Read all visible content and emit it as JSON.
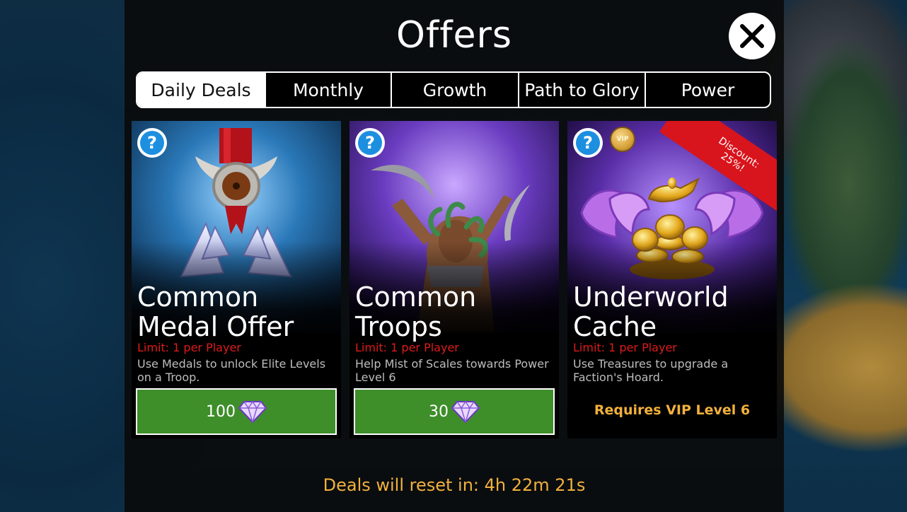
{
  "title": "Offers",
  "tabs": [
    {
      "label": "Daily Deals",
      "active": true
    },
    {
      "label": "Monthly",
      "active": false
    },
    {
      "label": "Growth",
      "active": false
    },
    {
      "label": "Path to Glory",
      "active": false
    },
    {
      "label": "Power",
      "active": false
    }
  ],
  "help_glyph": "?",
  "offers": [
    {
      "title": "Common\nMedal Offer",
      "limit": "Limit: 1 per Player",
      "description": "Use Medals to unlock Elite Levels on a Troop.",
      "price": "100",
      "currency_icon": "gem-icon"
    },
    {
      "title": "Common\nTroops",
      "limit": "Limit: 1 per Player",
      "description": "Help Mist of Scales towards Power Level 6",
      "price": "30",
      "currency_icon": "gem-icon"
    },
    {
      "title": "Underworld\nCache",
      "limit": "Limit: 1 per Player",
      "description": "Use Treasures to upgrade a Faction's Hoard.",
      "discount_line1": "Discount:",
      "discount_line2": "25%!",
      "vip_badge": "VIP",
      "requirement": "Requires VIP Level 6"
    }
  ],
  "reset_text": "Deals will reset in: 4h 22m 21s",
  "colors": {
    "buy_green": "#3e8e2a",
    "limit_red": "#e01b1b",
    "gold_text": "#f2b13c",
    "help_blue": "#1d8fe0",
    "discount_red": "#d8141c"
  }
}
